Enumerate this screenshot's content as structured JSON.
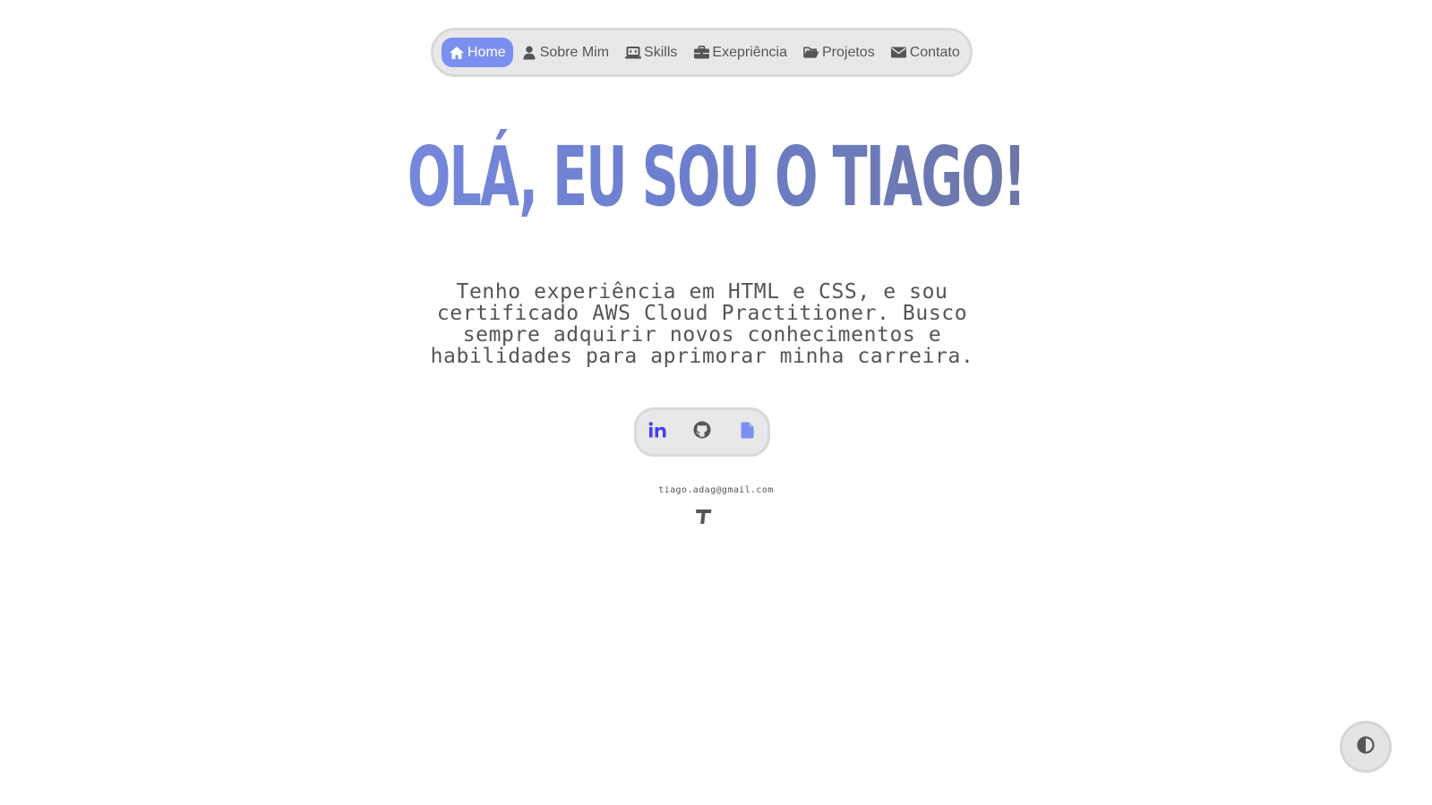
{
  "nav": {
    "items": [
      {
        "label": "Home",
        "icon": "home-icon",
        "active": true
      },
      {
        "label": "Sobre Mim",
        "icon": "user-icon",
        "active": false
      },
      {
        "label": "Skills",
        "icon": "laptop-code-icon",
        "active": false
      },
      {
        "label": "Exepriência",
        "icon": "briefcase-icon",
        "active": false
      },
      {
        "label": "Projetos",
        "icon": "folder-open-icon",
        "active": false
      },
      {
        "label": "Contato",
        "icon": "envelope-icon",
        "active": false
      }
    ]
  },
  "hero": {
    "title": "OLÁ, EU SOU O TIAGO!",
    "intro": "Tenho experiência em HTML e CSS, e sou certificado AWS Cloud Practitioner. Busco sempre adquirir novos conhecimentos e habilidades para aprimorar minha carreira."
  },
  "social": {
    "links": [
      {
        "icon": "linkedin-icon",
        "color": "#4a3cf0"
      },
      {
        "icon": "github-icon",
        "color": "#555555"
      },
      {
        "icon": "document-icon",
        "color": "#7b8ff0"
      }
    ]
  },
  "footer": {
    "email": "tiago.adag@gmail.com",
    "logo_icon": "t-logo-icon"
  },
  "theme_toggle": {
    "icon": "contrast-icon"
  },
  "colors": {
    "accent": "#7b8ff0",
    "text": "#555555",
    "nav_bg": "#e8e8e8"
  }
}
